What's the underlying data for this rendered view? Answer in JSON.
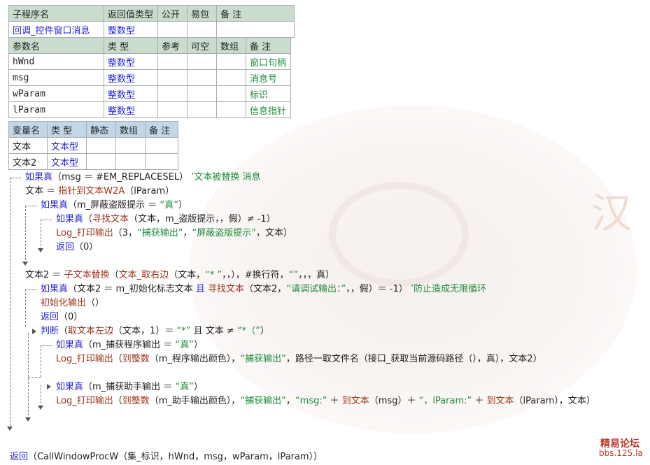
{
  "sub_table": {
    "headers": [
      "子程序名",
      "返回值类型",
      "公开",
      "易包",
      "备 注"
    ],
    "row": [
      "回调_控件窗口消息",
      "整数型",
      "",
      "",
      ""
    ]
  },
  "param_table": {
    "headers": [
      "参数名",
      "类 型",
      "参考",
      "可空",
      "数组",
      "备 注"
    ],
    "rows": [
      [
        "hWnd",
        "整数型",
        "",
        "",
        "",
        "窗口句柄"
      ],
      [
        "msg",
        "整数型",
        "",
        "",
        "",
        "消息号"
      ],
      [
        "wParam",
        "整数型",
        "",
        "",
        "",
        "标识"
      ],
      [
        "lParam",
        "整数型",
        "",
        "",
        "",
        "信息指针"
      ]
    ]
  },
  "var_table": {
    "headers": [
      "变量名",
      "类 型",
      "静态",
      "数组",
      "备 注"
    ],
    "rows": [
      [
        "文本",
        "文本型",
        "",
        "",
        ""
      ],
      [
        "文本2",
        "文本型",
        "",
        "",
        ""
      ]
    ]
  },
  "code": [
    [
      {
        "t": "如果真",
        "c": "kw"
      },
      {
        "t": "（msg ＝ #EM_REPLACESEL） ",
        "c": "tx"
      },
      {
        "t": "’文本被替换 消息",
        "c": "cm"
      }
    ],
    [
      {
        "t": "文本 ＝ ",
        "c": "tx"
      },
      {
        "t": "指针到文本W2A",
        "c": "fn"
      },
      {
        "t": "（lParam）",
        "c": "tx"
      }
    ],
    [
      {
        "t": "如果真",
        "c": "kw"
      },
      {
        "t": "（m_屏蔽盗版提示 ＝ ",
        "c": "tx"
      },
      {
        "t": "“真”",
        "c": "str"
      },
      {
        "t": "）",
        "c": "tx"
      }
    ],
    [
      {
        "t": "如果真",
        "c": "kw"
      },
      {
        "t": "（",
        "c": "tx"
      },
      {
        "t": "寻找文本",
        "c": "fn"
      },
      {
        "t": "（文本，m_盗版提示，，假）≠ -1）",
        "c": "tx"
      }
    ],
    [
      {
        "t": "Log_打印输出",
        "c": "fn"
      },
      {
        "t": "（3，",
        "c": "tx"
      },
      {
        "t": "“捕获输出”",
        "c": "str"
      },
      {
        "t": "，",
        "c": "tx"
      },
      {
        "t": "“屏蔽盗版提示”",
        "c": "str"
      },
      {
        "t": "，文本）",
        "c": "tx"
      }
    ],
    [
      {
        "t": "返回",
        "c": "kw"
      },
      {
        "t": "（0）",
        "c": "tx"
      }
    ],
    [
      {
        "t": "文本2 ＝ ",
        "c": "tx"
      },
      {
        "t": "子文本替换",
        "c": "fn"
      },
      {
        "t": "（",
        "c": "tx"
      },
      {
        "t": "文本_取右边",
        "c": "fn"
      },
      {
        "t": "（文本，",
        "c": "tx"
      },
      {
        "t": "“* ”",
        "c": "str"
      },
      {
        "t": "，，），#换行符，",
        "c": "tx"
      },
      {
        "t": "“”",
        "c": "str"
      },
      {
        "t": "，，，真）",
        "c": "tx"
      }
    ],
    [
      {
        "t": "如果真",
        "c": "kw"
      },
      {
        "t": "（文本2 ＝ m_初始化标志文本 ",
        "c": "tx"
      },
      {
        "t": "且",
        "c": "kw"
      },
      {
        "t": " ",
        "c": "tx"
      },
      {
        "t": "寻找文本",
        "c": "fn"
      },
      {
        "t": "（文本2，",
        "c": "tx"
      },
      {
        "t": "“请调试输出：”",
        "c": "str"
      },
      {
        "t": "，，假）＝ -1） ",
        "c": "tx"
      },
      {
        "t": "’防止造成无限循环",
        "c": "cm"
      }
    ],
    [
      {
        "t": "初始化输出",
        "c": "fn"
      },
      {
        "t": "（）",
        "c": "tx"
      }
    ],
    [
      {
        "t": "返回",
        "c": "kw"
      },
      {
        "t": "（0）",
        "c": "tx"
      }
    ],
    [
      {
        "t": "判断",
        "c": "kw"
      },
      {
        "t": "（",
        "c": "tx"
      },
      {
        "t": "取文本左边",
        "c": "fn"
      },
      {
        "t": "（文本，1）＝ ",
        "c": "tx"
      },
      {
        "t": "“*”",
        "c": "str"
      },
      {
        "t": " 且 文本 ≠ ",
        "c": "tx"
      },
      {
        "t": "“*（”",
        "c": "str"
      },
      {
        "t": "）",
        "c": "tx"
      }
    ],
    [
      {
        "t": "如果真",
        "c": "kw"
      },
      {
        "t": "（m_捕获程序输出 ＝ ",
        "c": "tx"
      },
      {
        "t": "“真”",
        "c": "str"
      },
      {
        "t": "）",
        "c": "tx"
      }
    ],
    [
      {
        "t": "Log_打印输出",
        "c": "fn"
      },
      {
        "t": "（",
        "c": "tx"
      },
      {
        "t": "到整数",
        "c": "fn"
      },
      {
        "t": "（m_程序输出颜色），",
        "c": "tx"
      },
      {
        "t": "“捕获输出”",
        "c": "str"
      },
      {
        "t": "，路径一取文件名（接口_获取当前源码路径（），真），文本2）",
        "c": "tx"
      }
    ],
    [
      {
        "t": "如果真",
        "c": "kw"
      },
      {
        "t": "（m_捕获助手输出 ＝ ",
        "c": "tx"
      },
      {
        "t": "“真”",
        "c": "str"
      },
      {
        "t": "）",
        "c": "tx"
      }
    ],
    [
      {
        "t": "Log_打印输出",
        "c": "fn"
      },
      {
        "t": "（",
        "c": "tx"
      },
      {
        "t": "到整数",
        "c": "fn"
      },
      {
        "t": "（m_助手输出颜色），",
        "c": "tx"
      },
      {
        "t": "“捕获输出”",
        "c": "str"
      },
      {
        "t": "，",
        "c": "tx"
      },
      {
        "t": "“msg:”",
        "c": "str"
      },
      {
        "t": " ＋ ",
        "c": "tx"
      },
      {
        "t": "到文本",
        "c": "fn"
      },
      {
        "t": "（msg）＋ ",
        "c": "tx"
      },
      {
        "t": "“，lParam:”",
        "c": "str"
      },
      {
        "t": " ＋ ",
        "c": "tx"
      },
      {
        "t": "到文本",
        "c": "fn"
      },
      {
        "t": "（lParam），文本）",
        "c": "tx"
      }
    ],
    [
      {
        "t": "返回",
        "c": "kw"
      },
      {
        "t": "（CallWindowProcW（集_标识，hWnd，msg，wParam，lParam））",
        "c": "tx"
      }
    ]
  ],
  "watermark": {
    "char": "汉",
    "logo_name": "精易论坛",
    "logo_url": "bbs.125.la"
  }
}
